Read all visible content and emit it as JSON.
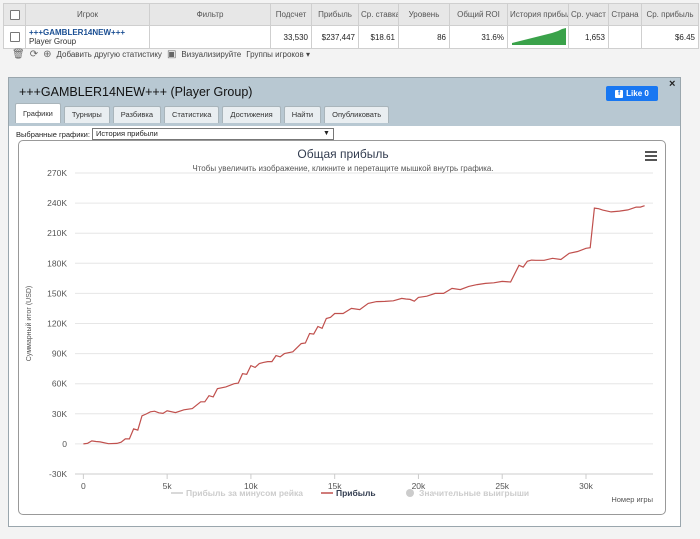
{
  "stats_table": {
    "headers": [
      "Игрок",
      "Фильтр",
      "Подсчет",
      "Прибыль",
      "Ср. ставка",
      "Уровень",
      "Общий ROI",
      "История прибыли",
      "Ср. участ",
      "Страна",
      "Ср. прибыль"
    ],
    "row": {
      "player_name": "+++GAMBLER14NEW+++",
      "player_type": "Player Group",
      "filter": "",
      "count": "33,530",
      "profit": "$237,447",
      "avg_stake": "$18.61",
      "level": "86",
      "total_roi": "31.6%",
      "avg_entrants": "1,653",
      "country": "",
      "avg_profit": "$6.45"
    }
  },
  "toolbar": {
    "add_stats": "Добавить другую статистику",
    "visualize": "Визуализируйте",
    "player_groups": "Группы игроков"
  },
  "panel": {
    "title": "+++GAMBLER14NEW+++ (Player Group)",
    "like_label": "Like 0",
    "close": "×",
    "tabs": [
      "Графики",
      "Турниры",
      "Разбивка",
      "Статистика",
      "Достижения",
      "Найти",
      "Опубликовать"
    ],
    "active_tab": 0,
    "select_label": "Выбранные графики:",
    "select_value": "История прибыли"
  },
  "chart_data": {
    "type": "line",
    "title": "Общая прибыль",
    "subtitle": "Чтобы увеличить изображение, кликните и перетащите мышкой внутрь графика.",
    "ylabel": "Суммарный итог (USD)",
    "xlabel": "Номер игры",
    "ylim": [
      -30000,
      270000
    ],
    "xlim": [
      -500,
      34000
    ],
    "yticks": [
      -30000,
      0,
      30000,
      60000,
      90000,
      120000,
      150000,
      180000,
      210000,
      240000,
      270000
    ],
    "ytick_labels": [
      "-30K",
      "0",
      "30K",
      "60K",
      "90K",
      "120K",
      "150K",
      "180K",
      "210K",
      "240K",
      "270K"
    ],
    "xticks": [
      0,
      5000,
      10000,
      15000,
      20000,
      25000,
      30000
    ],
    "xtick_labels": [
      "0",
      "5k",
      "10k",
      "15k",
      "20k",
      "25k",
      "30k"
    ],
    "legend": [
      {
        "name": "Прибыль за минусом рейка",
        "color": "#cccccc",
        "visible": false
      },
      {
        "name": "Прибыль",
        "color": "#c0504d",
        "visible": true
      },
      {
        "name": "Значительные выигрыши",
        "color": "#cccccc",
        "visible": false
      }
    ],
    "series": [
      {
        "name": "Прибыль",
        "color": "#c0504d",
        "x": [
          0,
          500,
          1000,
          2000,
          2500,
          3000,
          3500,
          4000,
          4500,
          5000,
          6000,
          7000,
          7500,
          8000,
          9000,
          9500,
          10000,
          10500,
          11000,
          11500,
          12000,
          13000,
          13500,
          14000,
          14500,
          15000,
          16000,
          17000,
          18000,
          19000,
          19500,
          20000,
          21000,
          22000,
          23000,
          24000,
          25000,
          26000,
          26500,
          27000,
          28000,
          29000,
          30000,
          30500,
          31000,
          32000,
          33000,
          33500
        ],
        "values": [
          0,
          3000,
          2000,
          500,
          5000,
          15000,
          28000,
          32000,
          31000,
          33000,
          34000,
          42000,
          48000,
          55000,
          60000,
          70000,
          78000,
          80000,
          82000,
          88000,
          90000,
          100000,
          110000,
          117000,
          125000,
          130000,
          135000,
          140000,
          142000,
          145000,
          144000,
          146000,
          150000,
          155000,
          157000,
          160000,
          162000,
          178000,
          182000,
          183000,
          185000,
          190000,
          195000,
          235000,
          233000,
          232000,
          236000,
          237447
        ]
      }
    ],
    "menu_icon": "hamburger-icon"
  }
}
